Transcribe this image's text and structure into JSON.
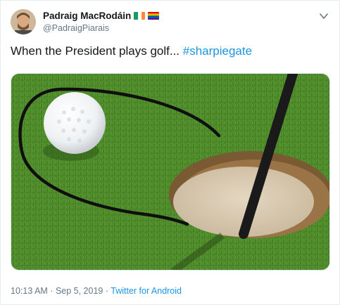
{
  "author": {
    "name": "Padraig MacRodáin",
    "handle": "@PadraigPiarais",
    "badges": [
      "ireland-flag-icon",
      "rainbow-flag-icon"
    ]
  },
  "tweet": {
    "text": "When the President plays golf... ",
    "hashtag": "#sharpiegate"
  },
  "media": {
    "description_icon": "golf-ball-photo"
  },
  "footer": {
    "time": "10:13 AM",
    "separator1": " · ",
    "date": "Sep 5, 2019",
    "separator2": " · ",
    "source": "Twitter for Android"
  },
  "colors": {
    "link": "#1b95e0",
    "secondary_text": "#657786",
    "border": "#e6ecf0"
  }
}
